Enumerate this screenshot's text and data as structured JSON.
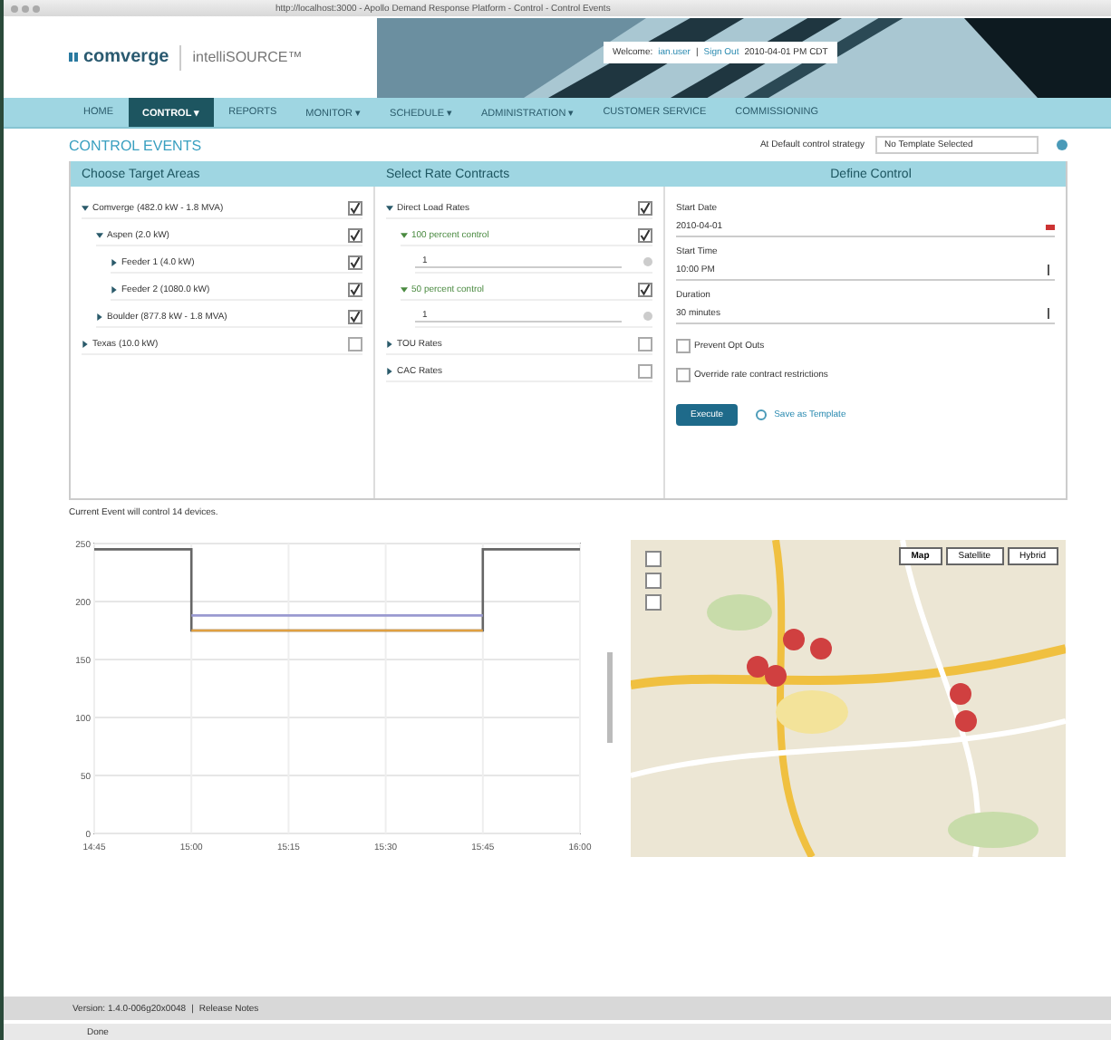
{
  "window": {
    "title": "http://localhost:3000 - Apollo Demand Response Platform - Control - Control Events"
  },
  "header": {
    "logo": "comverge",
    "product": "intelliSOURCE™",
    "welcome": "Welcome:",
    "user": "ian.user",
    "separator": "|",
    "sign_out": "Sign Out",
    "time": "2010-04-01 PM CDT"
  },
  "nav": [
    {
      "label": "HOME",
      "selected": false
    },
    {
      "label": "CONTROL ▾",
      "selected": true
    },
    {
      "label": "REPORTS",
      "selected": false
    },
    {
      "label": "MONITOR ▾",
      "selected": false
    },
    {
      "label": "SCHEDULE ▾",
      "selected": false
    },
    {
      "label": "ADMINISTRATION ▾",
      "selected": false
    },
    {
      "label": "CUSTOMER SERVICE",
      "selected": false
    },
    {
      "label": "COMMISSIONING",
      "selected": false
    }
  ],
  "page": {
    "title": "CONTROL EVENTS",
    "strategy_label": "At Default control strategy",
    "strategy_value": "No Template Selected"
  },
  "target_areas": {
    "title": "Choose Target Areas",
    "items": [
      {
        "label": "Comverge (482.0 kW - 1.8 MVA)",
        "expanded": true,
        "checked": true,
        "children": [
          {
            "label": "Aspen (2.0 kW)",
            "expanded": true,
            "checked": true,
            "children": [
              {
                "label": "Feeder 1 (4.0 kW)",
                "expanded": false,
                "checked": true
              },
              {
                "label": "Feeder 2 (1080.0 kW)",
                "expanded": false,
                "checked": true
              }
            ]
          },
          {
            "label": "Boulder (877.8 kW - 1.8 MVA)",
            "expanded": false,
            "checked": true
          }
        ]
      },
      {
        "label": "Texas (10.0 kW)",
        "expanded": false,
        "checked": false
      }
    ]
  },
  "rate_contracts": {
    "title": "Select Rate Contracts",
    "items": [
      {
        "label": "Direct Load Rates",
        "expanded": true,
        "checked": true,
        "children": [
          {
            "label": "100 percent control",
            "expanded": true,
            "checked": true,
            "value": "1"
          },
          {
            "label": "50 percent control",
            "expanded": true,
            "checked": true,
            "value": "1"
          }
        ]
      },
      {
        "label": "TOU Rates",
        "expanded": false,
        "checked": false
      },
      {
        "label": "CAC Rates",
        "expanded": false,
        "checked": false
      }
    ]
  },
  "define_control": {
    "title": "Define Control",
    "start_date_label": "Start Date",
    "start_date": "2010-04-01",
    "start_time_label": "Start Time",
    "start_time": "10:00 PM",
    "duration_label": "Duration",
    "duration": "30 minutes",
    "options": [
      {
        "label": "Prevent Opt Outs",
        "checked": false
      },
      {
        "label": "Override rate contract restrictions",
        "checked": false
      }
    ],
    "execute": "Execute",
    "save_template": "Save as Template"
  },
  "chart": {
    "caption": "Current Event will control 14 devices.",
    "chart_data": {
      "type": "line",
      "grid": true,
      "x": [
        885,
        900,
        900,
        945,
        945,
        960
      ],
      "xlim": [
        885,
        960
      ],
      "ylim": [
        0,
        250
      ],
      "xticks": [
        {
          "value": 885,
          "label": "14:45"
        },
        {
          "value": 900,
          "label": "15:00"
        },
        {
          "value": 915,
          "label": "15:15"
        },
        {
          "value": 930,
          "label": "15:30"
        },
        {
          "value": 945,
          "label": "15:45"
        },
        {
          "value": 960,
          "label": "16:00"
        }
      ],
      "yticks": [
        0,
        50,
        100,
        150,
        200,
        250
      ],
      "series": [
        {
          "color": "#666666",
          "values": [
            245,
            245,
            175,
            175,
            245,
            245
          ]
        },
        {
          "color": "#9a9ad0",
          "values": [
            null,
            null,
            188,
            188,
            null,
            null
          ]
        },
        {
          "color": "#e0a040",
          "values": [
            null,
            null,
            175,
            175,
            null,
            null
          ]
        }
      ]
    }
  },
  "map": {
    "kind": "picture",
    "types": [
      {
        "label": "Map",
        "selected": true
      },
      {
        "label": "Satellite",
        "selected": false
      },
      {
        "label": "Hybrid",
        "selected": false
      }
    ]
  },
  "footer": {
    "version": "Version: 1.4.0-006g20x0048",
    "separator": "|",
    "release_notes": "Release Notes"
  },
  "status_bar": {
    "text": "Done"
  }
}
